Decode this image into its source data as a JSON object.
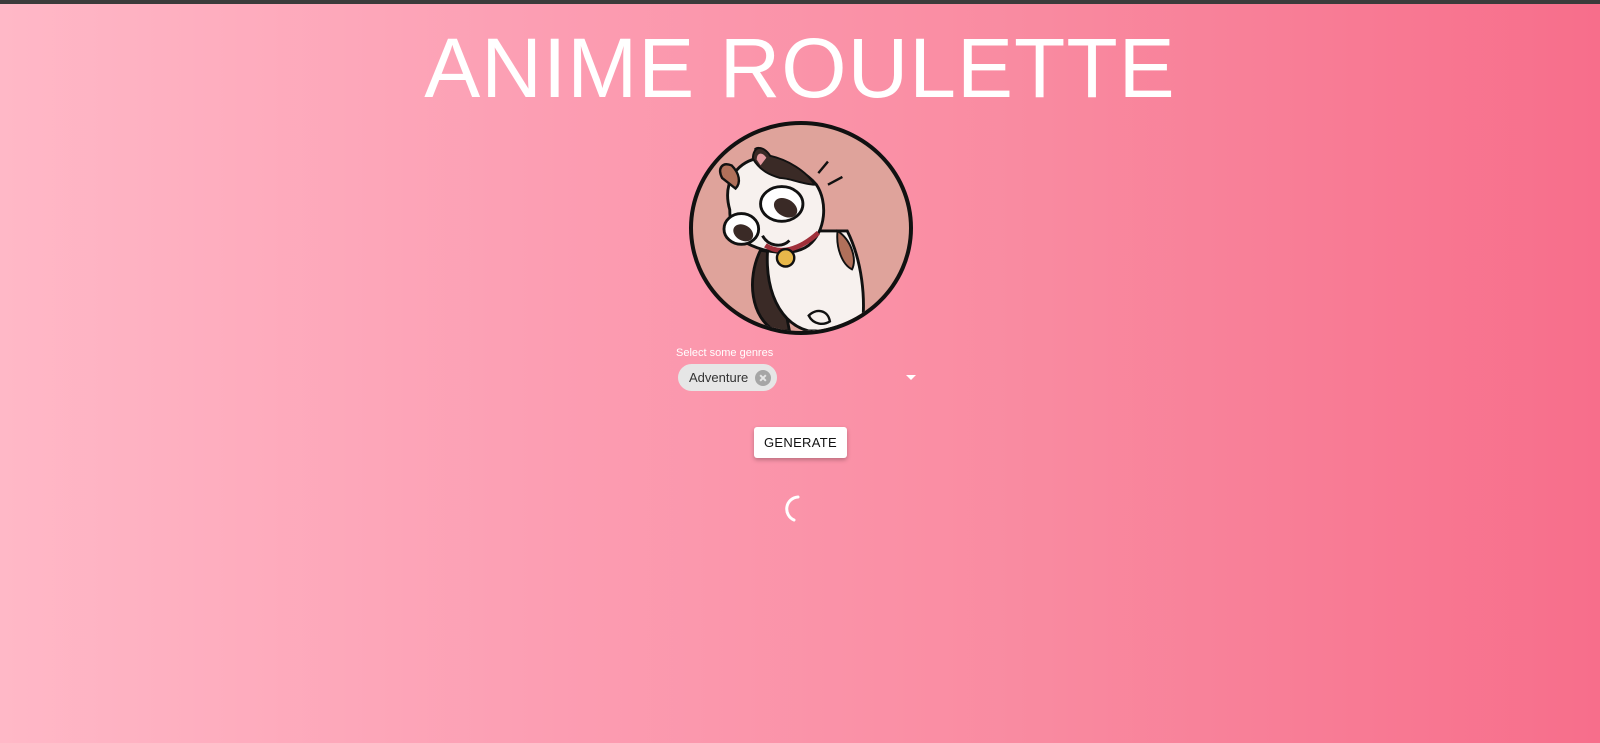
{
  "title": "ANIME ROULETTE",
  "genre_select": {
    "label": "Select some genres",
    "selected_chips": [
      "Adventure"
    ]
  },
  "generate_button": {
    "label": "GENERATE"
  },
  "colors": {
    "background_start": "#ffb8c7",
    "background_end": "#f76e8b",
    "title": "#ffffff",
    "chip_bg": "#e6e6e6"
  },
  "icons": {
    "avatar": "cartoon-calico-cat-icon",
    "chip_delete": "cancel-circle-icon",
    "dropdown": "chevron-down-icon",
    "loading": "loading-spinner-icon"
  }
}
